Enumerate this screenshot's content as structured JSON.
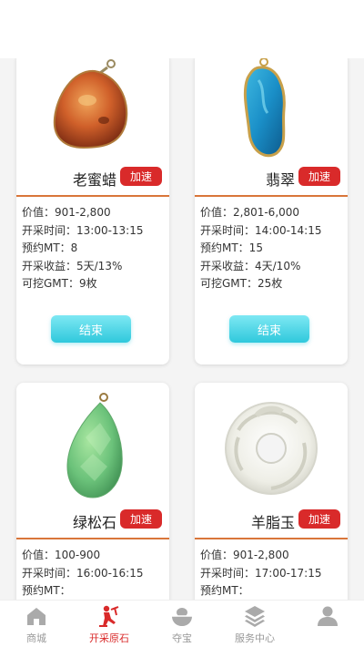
{
  "products": [
    {
      "name": "老蜜蜡",
      "speed_label": "加速",
      "price": "价值：901-2,800",
      "time": "开采时间：13:00-13:15",
      "reserve": "预约MT：8",
      "income": "开采收益：5天/13%",
      "gmt": "可挖GMT：9枚",
      "button": "结束",
      "image": "amber-pendant"
    },
    {
      "name": "翡翠",
      "speed_label": "加速",
      "price": "价值：2,801-6,000",
      "time": "开采时间：14:00-14:15",
      "reserve": "预约MT：15",
      "income": "开采收益：4天/10%",
      "gmt": "可挖GMT：25枚",
      "button": "结束",
      "image": "blue-jade-pendant"
    },
    {
      "name": "绿松石",
      "speed_label": "加速",
      "price": "价值：100-900",
      "time": "开采时间：16:00-16:15",
      "reserve": "预约MT：",
      "image": "green-turquoise-pendant"
    },
    {
      "name": "羊脂玉",
      "speed_label": "加速",
      "price": "价值：901-2,800",
      "time": "开采时间：17:00-17:15",
      "reserve": "预约MT：",
      "image": "white-jade-pendant"
    }
  ],
  "tabs": [
    {
      "label": "商城",
      "icon": "home-icon",
      "active": false
    },
    {
      "label": "开采原石",
      "icon": "miner-icon",
      "active": true
    },
    {
      "label": "夺宝",
      "icon": "treasure-bowl-icon",
      "active": false
    },
    {
      "label": "服务中心",
      "icon": "layers-icon",
      "active": false
    },
    {
      "label": "",
      "icon": "user-icon",
      "active": false
    }
  ],
  "colors": {
    "accent": "#d92a2a",
    "button_cyan": "#2fc8dc",
    "divider": "#d9763a",
    "inactive": "#999999"
  }
}
